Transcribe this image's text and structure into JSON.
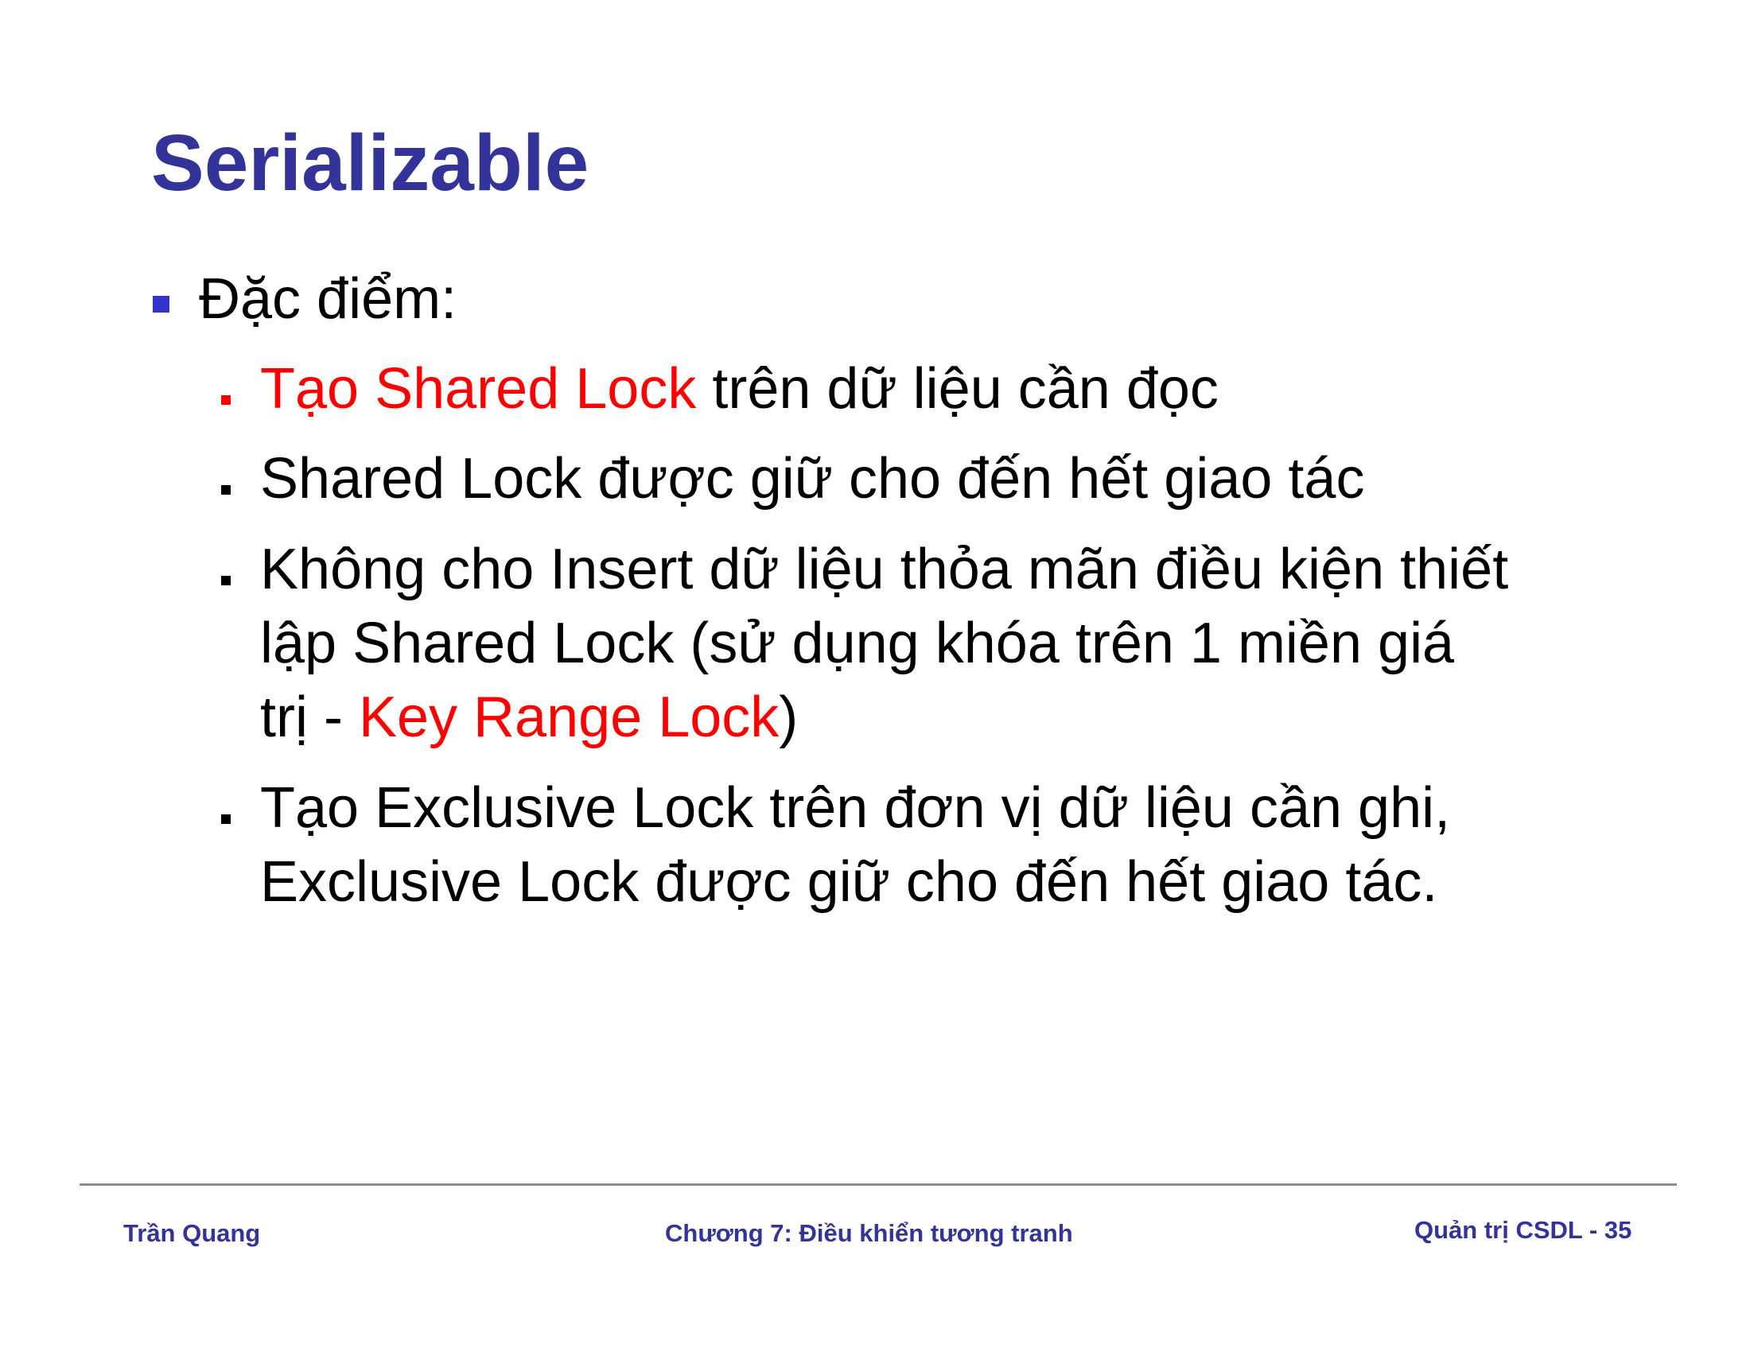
{
  "title": "Serializable",
  "level1": {
    "label": "Đặc điểm:"
  },
  "bullets": [
    {
      "red": "Tạo Shared Lock",
      "rest": " trên dữ liệu cần đọc"
    },
    {
      "text": "Shared Lock được giữ cho đến hết giao tác"
    },
    {
      "line1": "Không cho Insert dữ liệu thỏa mãn điều kiện thiết",
      "line2": "lập Shared Lock (sử dụng khóa trên 1 miền giá",
      "line3_pre": "trị - ",
      "line3_red": "Key Range Lock",
      "line3_post": ")"
    },
    {
      "line1": "Tạo Exclusive Lock trên đơn vị dữ liệu cần ghi,",
      "line2": "Exclusive Lock được giữ cho đến hết giao tác."
    }
  ],
  "footer": {
    "author": "Trần Quang",
    "chapter": "Chương 7: Điều khiển tương tranh",
    "course_page": "Quản trị CSDL - 35"
  },
  "colors": {
    "title": "#333399",
    "highlight": "#ff0000",
    "level1_bullet": "#3333cc",
    "footer_text": "#333399",
    "footer_rule": "#8c8c8c"
  }
}
